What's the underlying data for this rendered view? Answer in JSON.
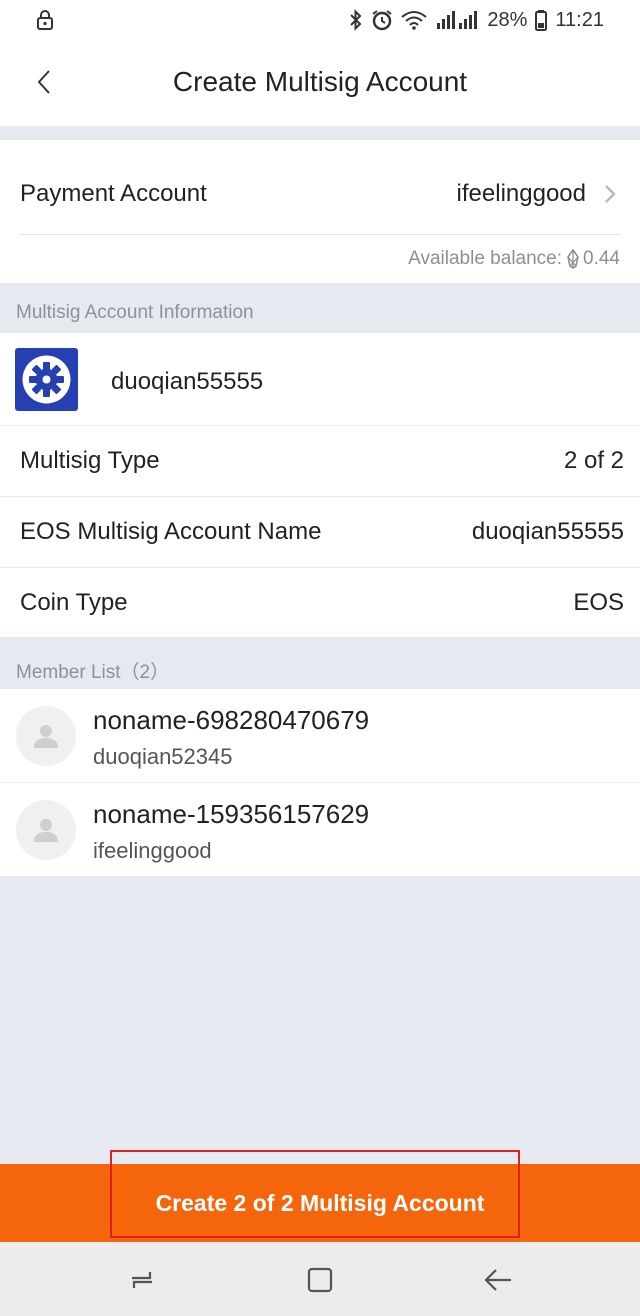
{
  "status_bar": {
    "battery": "28%",
    "time": "11:21"
  },
  "header": {
    "title": "Create Multisig Account"
  },
  "payment": {
    "label": "Payment Account",
    "value": "ifeelinggood",
    "balance_label": "Available balance:",
    "balance_value": "0.44"
  },
  "multisig_section": {
    "title": "Multisig Account Information",
    "account_name": "duoqian55555",
    "rows": [
      {
        "label": "Multisig Type",
        "value": "2 of 2"
      },
      {
        "label": "EOS Multisig Account Name",
        "value": "duoqian55555"
      },
      {
        "label": "Coin Type",
        "value": "EOS"
      }
    ]
  },
  "members": {
    "title": "Member List（2）",
    "items": [
      {
        "name": "noname-698280470679",
        "account": "duoqian52345"
      },
      {
        "name": "noname-159356157629",
        "account": "ifeelinggood"
      }
    ]
  },
  "actions": {
    "create_label": "Create 2 of 2 Multisig Account"
  },
  "colors": {
    "accent": "#f5650b",
    "highlight_border": "#e02020",
    "logo_bg": "#2540b3",
    "page_bg": "#e6e9ef"
  },
  "icons": {
    "status_lock": "lock-icon",
    "bluetooth": "bluetooth-icon",
    "alarm": "alarm-icon",
    "wifi": "wifi-icon",
    "signal": "signal-icon",
    "battery": "battery-icon",
    "back": "chevron-left-icon",
    "payment_chevron": "chevron-right-icon",
    "eos": "eos-icon",
    "logo": "gear-logo-icon",
    "avatar": "user-icon",
    "nav_recent": "recent-apps-icon",
    "nav_home": "home-icon",
    "nav_back": "back-arrow-icon"
  }
}
